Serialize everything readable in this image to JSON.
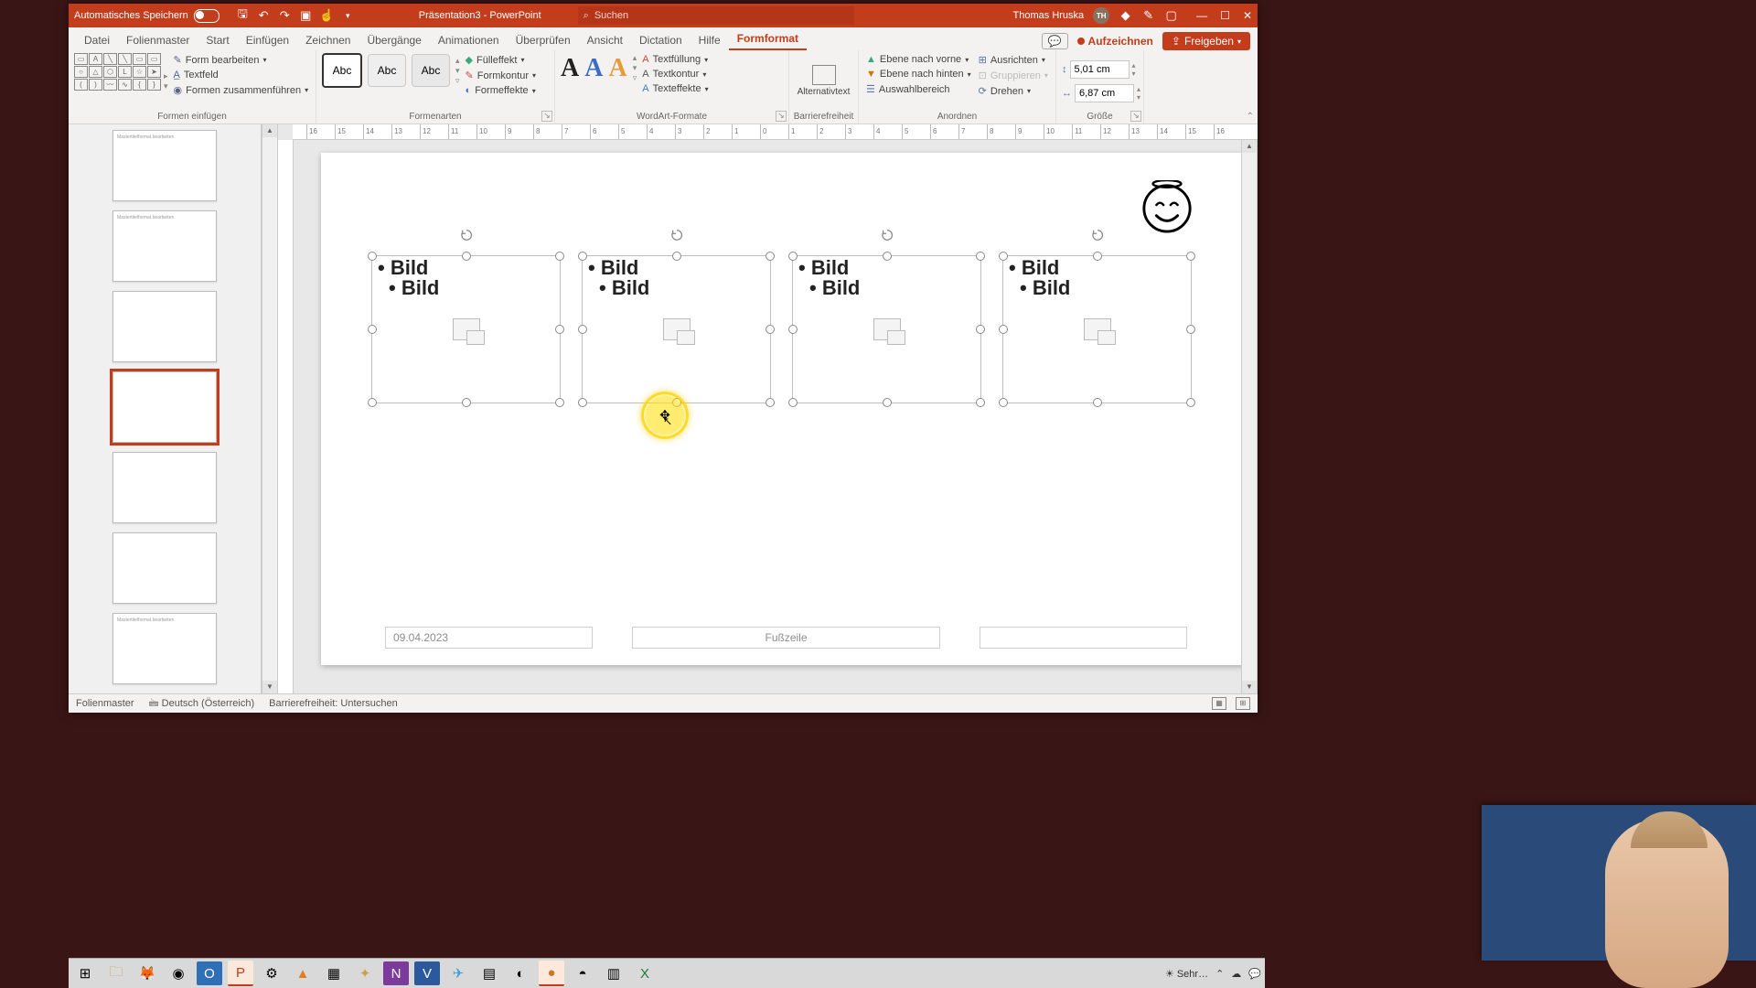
{
  "titlebar": {
    "autosave": "Automatisches Speichern",
    "doc": "Präsentation3 - PowerPoint",
    "search_placeholder": "Suchen",
    "user": "Thomas Hruska",
    "initials": "TH"
  },
  "tabs": {
    "datei": "Datei",
    "folienmaster": "Folienmaster",
    "start": "Start",
    "einfuegen": "Einfügen",
    "zeichnen": "Zeichnen",
    "uebergaenge": "Übergänge",
    "animationen": "Animationen",
    "ueberpruefen": "Überprüfen",
    "ansicht": "Ansicht",
    "dictation": "Dictation",
    "hilfe": "Hilfe",
    "formformat": "Formformat",
    "aufzeichnen": "Aufzeichnen",
    "freigeben": "Freigeben"
  },
  "ribbon": {
    "formen": {
      "bearbeiten": "Form bearbeiten",
      "textfeld": "Textfeld",
      "zusammen": "Formen zusammenführen",
      "label": "Formen einfügen"
    },
    "formenarten": {
      "sample": "Abc",
      "fuell": "Fülleffekt",
      "kontur": "Formkontur",
      "effekte": "Formeffekte",
      "label": "Formenarten"
    },
    "wordart": {
      "textfuell": "Textfüllung",
      "textkontur": "Textkontur",
      "texteffekte": "Texteffekte",
      "label": "WordArt-Formate"
    },
    "barrierefrei": {
      "alt": "Alternativtext",
      "label": "Barrierefreiheit"
    },
    "anordnen": {
      "vorne": "Ebene nach vorne",
      "hinten": "Ebene nach hinten",
      "auswahl": "Auswahlbereich",
      "ausrichten": "Ausrichten",
      "gruppieren": "Gruppieren",
      "drehen": "Drehen",
      "label": "Anordnen"
    },
    "groesse": {
      "h": "5,01 cm",
      "w": "6,87 cm",
      "label": "Größe"
    }
  },
  "slide": {
    "ph_text1": "Bild",
    "ph_text2": "Bild",
    "date": "09.04.2023",
    "footer": "Fußzeile"
  },
  "statusbar": {
    "mode": "Folienmaster",
    "lang": "Deutsch (Österreich)",
    "access": "Barrierefreiheit: Untersuchen"
  },
  "tray": {
    "weather": "Sehr…"
  },
  "ruler_h": [
    "16",
    "15",
    "14",
    "13",
    "12",
    "11",
    "10",
    "9",
    "8",
    "7",
    "6",
    "5",
    "4",
    "3",
    "2",
    "1",
    "0",
    "1",
    "2",
    "3",
    "4",
    "5",
    "6",
    "7",
    "8",
    "9",
    "10",
    "11",
    "12",
    "13",
    "14",
    "15",
    "16"
  ]
}
